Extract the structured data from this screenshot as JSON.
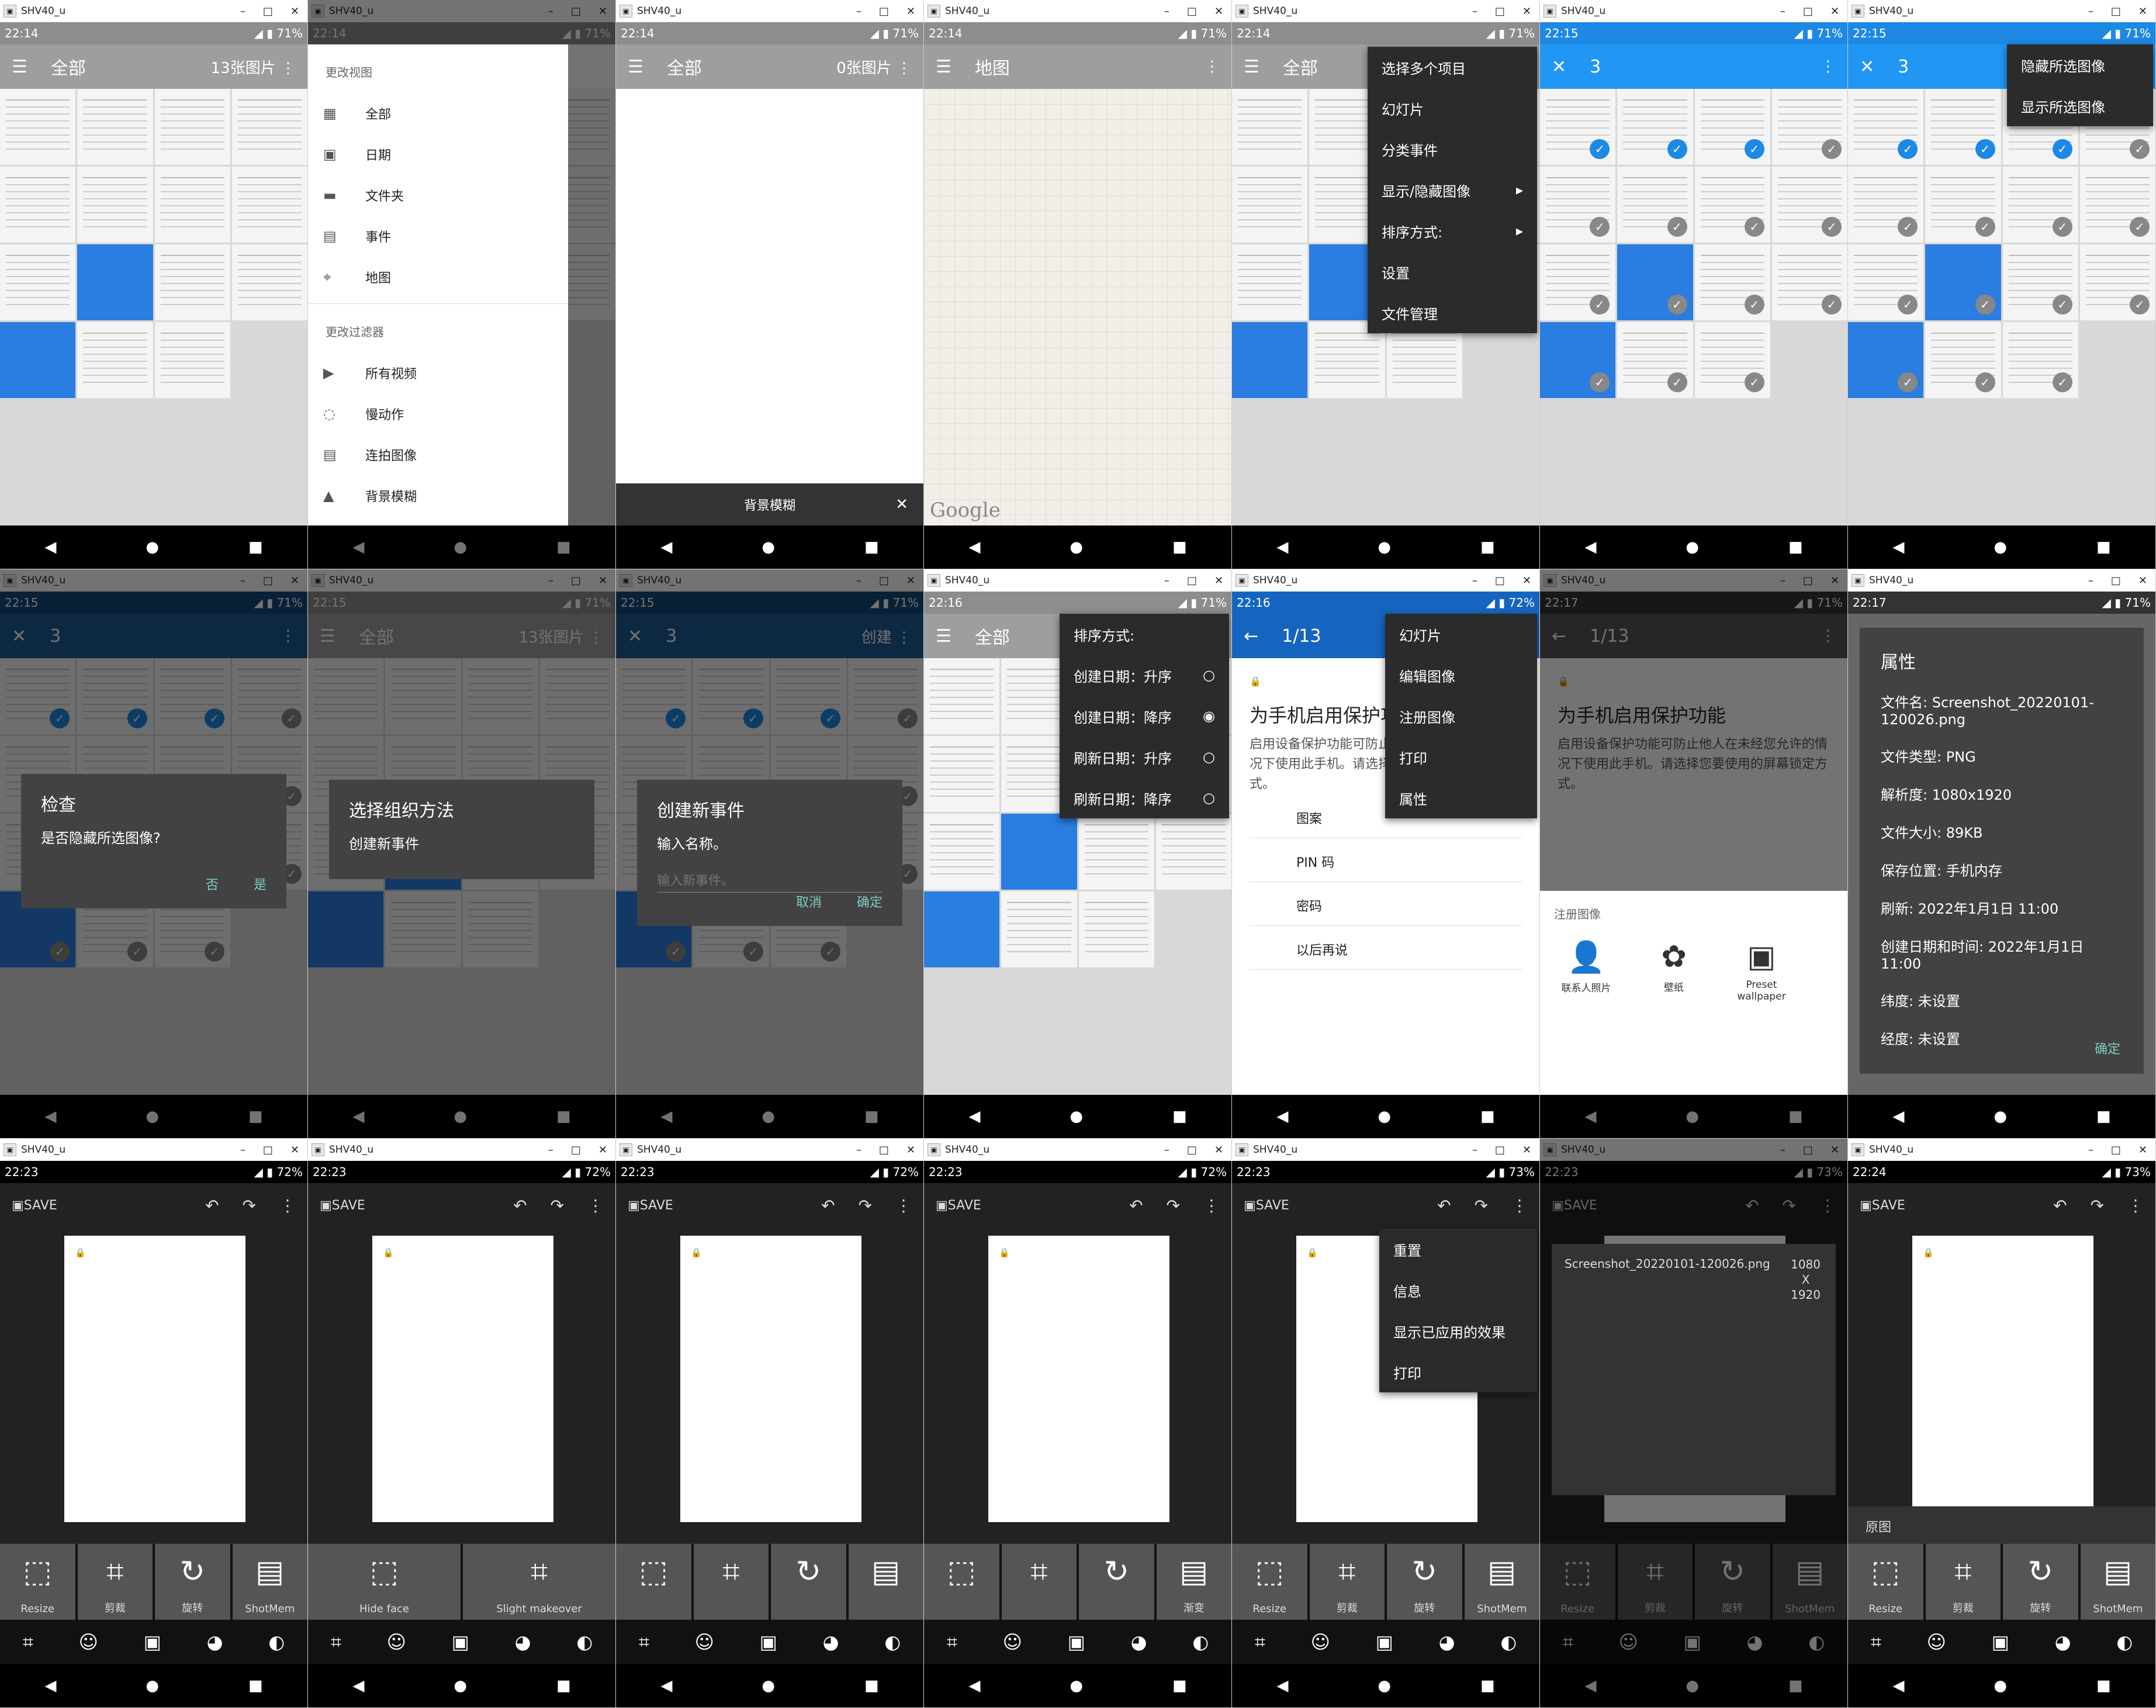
{
  "window_title": "SHV40_u",
  "panels": [
    {
      "time": "22:14",
      "battery": "71%",
      "toolbar_title": "全部",
      "toolbar_right": "13张图片",
      "toolbar_color": "#9e9e9e",
      "status_color": "#8a8a8a",
      "type": "gallery"
    },
    {
      "time": "22:14",
      "battery": "71%",
      "type": "drawer",
      "drawer": {
        "header_view": "更改视图",
        "items_view": [
          "全部",
          "日期",
          "文件夹",
          "事件",
          "地图"
        ],
        "header_filter": "更改过滤器",
        "items_filter": [
          "所有视频",
          "慢动作",
          "连拍图像",
          "背景模糊"
        ]
      }
    },
    {
      "time": "22:14",
      "battery": "71%",
      "toolbar_title": "全部",
      "toolbar_right": "0张图片",
      "type": "empty",
      "snackbar": "背景模糊"
    },
    {
      "time": "22:14",
      "battery": "71%",
      "toolbar_title": "地图",
      "type": "map",
      "watermark": "Google"
    },
    {
      "time": "22:14",
      "battery": "71%",
      "toolbar_title": "全部",
      "type": "menu",
      "menu": [
        "选择多个项目",
        "幻灯片",
        "分类事件",
        "显示/隐藏图像",
        "排序方式:",
        "设置",
        "文件管理"
      ]
    },
    {
      "time": "22:15",
      "battery": "71%",
      "selected_count": "3",
      "type": "select"
    },
    {
      "time": "22:15",
      "battery": "71%",
      "selected_count": "3",
      "type": "select_menu",
      "menu": [
        "隐藏所选图像",
        "显示所选图像"
      ]
    },
    {
      "time": "22:15",
      "battery": "71%",
      "selected_count": "3",
      "type": "dialog",
      "dialog": {
        "title": "检查",
        "message": "是否隐藏所选图像?",
        "cancel": "否",
        "ok": "是"
      }
    },
    {
      "time": "22:15",
      "battery": "71%",
      "toolbar_title": "全部",
      "toolbar_right": "13张图片",
      "type": "dialog2",
      "dialog": {
        "title": "选择组织方法",
        "option": "创建新事件"
      }
    },
    {
      "time": "22:15",
      "battery": "71%",
      "selected_count": "3",
      "toolbar_right": "创建",
      "type": "dialog3",
      "dialog": {
        "title": "创建新事件",
        "message": "输入名称。",
        "placeholder": "输入新事件。",
        "cancel": "取消",
        "ok": "确定"
      }
    },
    {
      "time": "22:16",
      "battery": "71%",
      "toolbar_title": "全部",
      "type": "sort",
      "sort": {
        "title": "排序方式:",
        "options": [
          "创建日期：升序",
          "创建日期：降序",
          "刷新日期：升序",
          "刷新日期：降序"
        ],
        "selected": 1
      }
    },
    {
      "time": "22:16",
      "battery": "72%",
      "counter": "1/13",
      "type": "viewer_menu",
      "doc": {
        "title": "为手机启用保护功能",
        "body": "启用设备保护功能可防止他人在未经您允许的情况下使用此手机。请选择您要使用的屏幕锁定方式。",
        "options": [
          "图案",
          "PIN 码",
          "密码",
          "以后再说"
        ]
      },
      "menu": [
        "幻灯片",
        "编辑图像",
        "注册图像",
        "打印",
        "属性"
      ]
    },
    {
      "time": "22:17",
      "battery": "71%",
      "counter": "1/13",
      "type": "register",
      "doc": {
        "title": "为手机启用保护功能",
        "body": "启用设备保护功能可防止他人在未经您允许的情况下使用此手机。请选择您要使用的屏幕锁定方式。"
      },
      "register": {
        "title": "注册图像",
        "apps": [
          "联系人照片",
          "壁纸",
          "Preset wallpaper"
        ]
      }
    },
    {
      "time": "22:17",
      "battery": "71%",
      "type": "props",
      "props": {
        "title": "属性",
        "rows": [
          "文件名: Screenshot_20220101-120026.png",
          "文件类型: PNG",
          "解析度: 1080x1920",
          "文件大小: 89KB",
          "保存位置: 手机内存",
          "刷新: 2022年1月1日 11:00",
          "创建日期和时间: 2022年1月1日 11:00",
          "纬度: 未设置",
          "经度: 未设置"
        ],
        "ok": "确定"
      }
    },
    {
      "time": "22:23",
      "battery": "72%",
      "type": "editor",
      "save": "SAVE",
      "tools": [
        "Resize",
        "剪裁",
        "旋转",
        "ShotMem"
      ]
    },
    {
      "time": "22:23",
      "battery": "72%",
      "type": "editor",
      "save": "SAVE",
      "tools": [
        "Hide face",
        "Slight makeover"
      ]
    },
    {
      "time": "22:23",
      "battery": "72%",
      "type": "editor",
      "save": "SAVE",
      "tools": [
        "",
        "",
        "",
        ""
      ]
    },
    {
      "time": "22:23",
      "battery": "72%",
      "type": "editor",
      "save": "SAVE",
      "tools": [
        "",
        "",
        "",
        "渐变"
      ]
    },
    {
      "time": "22:23",
      "battery": "73%",
      "type": "editor_menu",
      "save": "SAVE",
      "tools": [
        "Resize",
        "剪裁",
        "旋转",
        "ShotMem"
      ],
      "menu": [
        "重置",
        "信息",
        "显示已应用的效果",
        "打印"
      ]
    },
    {
      "time": "22:23",
      "battery": "73%",
      "type": "editor_info",
      "save": "SAVE",
      "tools": [
        "Resize",
        "剪裁",
        "旋转",
        "ShotMem"
      ],
      "info": {
        "filename": "Screenshot_20220101-120026.png",
        "w": "1080",
        "x": "X",
        "h": "1920"
      }
    },
    {
      "time": "22:24",
      "battery": "73%",
      "type": "editor",
      "save": "SAVE",
      "tools": [
        "Resize",
        "剪裁",
        "旋转",
        "ShotMem"
      ],
      "original": "原图"
    }
  ]
}
